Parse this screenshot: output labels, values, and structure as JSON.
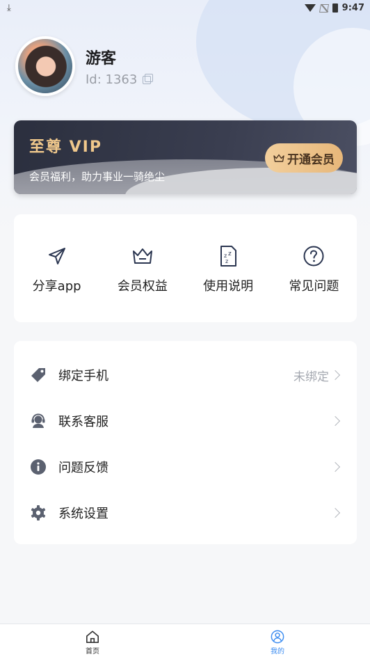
{
  "status_bar": {
    "time": "9:47"
  },
  "profile": {
    "name": "游客",
    "id_text": "Id: 1363"
  },
  "vip": {
    "title": "至尊 VIP",
    "subtitle": "会员福利，助力事业一骑绝尘",
    "button_label": "开通会员"
  },
  "quick_actions": [
    {
      "label": "分享app",
      "icon": "send-icon"
    },
    {
      "label": "会员权益",
      "icon": "crown-icon"
    },
    {
      "label": "使用说明",
      "icon": "document-icon"
    },
    {
      "label": "常见问题",
      "icon": "question-icon"
    }
  ],
  "menu": [
    {
      "label": "绑定手机",
      "value": "未绑定",
      "icon": "tag-icon"
    },
    {
      "label": "联系客服",
      "value": "",
      "icon": "customer-service-icon"
    },
    {
      "label": "问题反馈",
      "value": "",
      "icon": "info-icon"
    },
    {
      "label": "系统设置",
      "value": "",
      "icon": "gear-icon"
    }
  ],
  "bottom_nav": [
    {
      "label": "首页",
      "icon": "home-icon"
    },
    {
      "label": "我的",
      "icon": "user-icon"
    }
  ],
  "colors": {
    "accent": "#3b8cf0",
    "vip_gold": "#f0c88c"
  }
}
